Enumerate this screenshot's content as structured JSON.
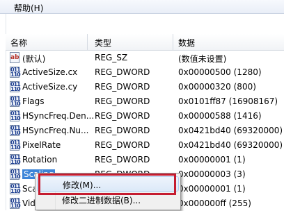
{
  "menubar": {
    "fragment": "l",
    "help": "帮助(H)"
  },
  "columns": {
    "name": "名称",
    "type": "类型",
    "data": "数据"
  },
  "rows": [
    {
      "icon": "ab",
      "name": "(默认)",
      "type": "REG_SZ",
      "data": "(数值未设置)"
    },
    {
      "icon": "011",
      "name": "ActiveSize.cx",
      "type": "REG_DWORD",
      "data": "0x00000500 (1280)"
    },
    {
      "icon": "011",
      "name": "ActiveSize.cy",
      "type": "REG_DWORD",
      "data": "0x00000320 (800)"
    },
    {
      "icon": "011",
      "name": "Flags",
      "type": "REG_DWORD",
      "data": "0x0101ff87 (16908167)"
    },
    {
      "icon": "011",
      "name": "HSyncFreq.Den...",
      "type": "REG_DWORD",
      "data": "0x00000588 (1416)"
    },
    {
      "icon": "011",
      "name": "HSyncFreq.Nu...",
      "type": "REG_DWORD",
      "data": "0x0421bd40 (69320000)"
    },
    {
      "icon": "011",
      "name": "PixelRate",
      "type": "REG_DWORD",
      "data": "0x0421bd40 (69320000)"
    },
    {
      "icon": "011",
      "name": "Rotation",
      "type": "REG_DWORD",
      "data": "0x00000001 (1)"
    },
    {
      "icon": "011",
      "name": "Scaling",
      "type": "REG_DWORD",
      "data": "0x00000003 (3)"
    },
    {
      "icon": "011",
      "name": "Sca",
      "type": "REG_DWORD",
      "data": "0x00000001 (1)"
    },
    {
      "icon": "011",
      "name": "Vide",
      "type": "REG_DWORD",
      "data": "0x000000ff (255)"
    }
  ],
  "context_menu": {
    "modify": "修改(M)...",
    "modify_binary": "修改二进制数据(B)..."
  }
}
